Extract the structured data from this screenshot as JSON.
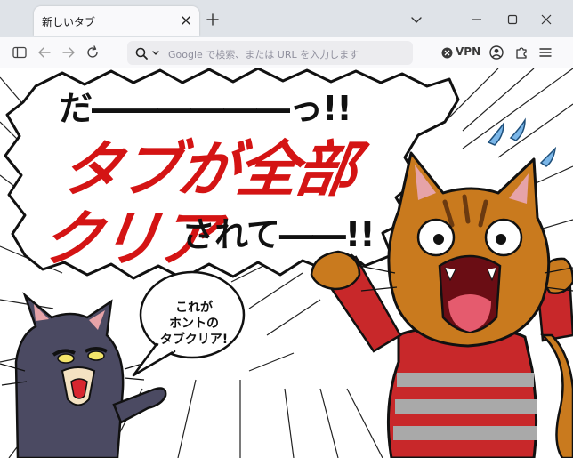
{
  "browser": {
    "tab_title": "新しいタブ",
    "url_placeholder": "Google で検索、または URL を入力します",
    "vpn_label": "VPN"
  },
  "content": {
    "headline_line1": "だ――――――っ!!",
    "headline_line2": "タブが全部",
    "headline_line3_red": "クリア",
    "headline_line3_black": "されて――!!",
    "small_bubble_lines": [
      "これが",
      "ホントの",
      "タブクリア!"
    ]
  },
  "colors": {
    "title_bar": "#dfe3e8",
    "toolbar": "#f9f9fb",
    "accent_red": "#d41414",
    "cat_orange": "#c97a1e",
    "cat_gray": "#4b4a62",
    "stripe_red": "#c8282a",
    "stripe_gray": "#a9a9a9"
  },
  "icons": [
    "close-icon",
    "plus-icon",
    "chevron-down-icon",
    "minimize-icon",
    "maximize-icon",
    "sidebar-icon",
    "back-arrow-icon",
    "forward-arrow-icon",
    "reload-icon",
    "search-icon",
    "vpn-icon",
    "account-icon",
    "extensions-icon",
    "menu-icon"
  ]
}
